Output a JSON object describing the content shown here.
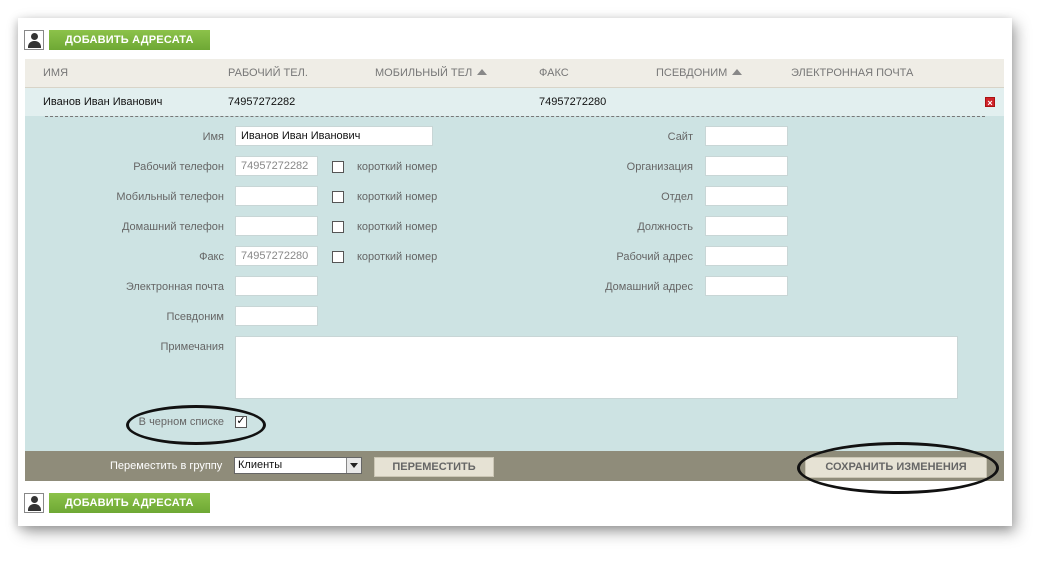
{
  "actions": {
    "add_recipient_label": "ДОБАВИТЬ АДРЕСАТА"
  },
  "table": {
    "headers": {
      "name": "ИМЯ",
      "work_phone": "РАБОЧИЙ ТЕЛ.",
      "mobile_phone": "МОБИЛЬНЫЙ ТЕЛ",
      "fax": "ФАКС",
      "alias": "ПСЕВДОНИМ",
      "email": "ЭЛЕКТРОННАЯ ПОЧТА"
    },
    "row": {
      "name": "Иванов Иван Иванович",
      "work_phone": "74957272282",
      "mobile_phone": "",
      "fax": "74957272280",
      "alias": "",
      "email": ""
    }
  },
  "form": {
    "name": {
      "label": "Имя",
      "value": "Иванов Иван Иванович"
    },
    "work_phone": {
      "label": "Рабочий телефон",
      "value": "74957272282"
    },
    "mobile_phone": {
      "label": "Мобильный телефон",
      "value": ""
    },
    "home_phone": {
      "label": "Домашний телефон",
      "value": ""
    },
    "fax": {
      "label": "Факс",
      "value": "74957272280"
    },
    "email": {
      "label": "Электронная почта",
      "value": ""
    },
    "alias": {
      "label": "Псевдоним",
      "value": ""
    },
    "notes": {
      "label": "Примечания",
      "value": ""
    },
    "short_number_label": "короткий номер",
    "site": {
      "label": "Сайт",
      "value": ""
    },
    "organization": {
      "label": "Организация",
      "value": ""
    },
    "department": {
      "label": "Отдел",
      "value": ""
    },
    "position": {
      "label": "Должность",
      "value": ""
    },
    "work_address": {
      "label": "Рабочий адрес",
      "value": ""
    },
    "home_address": {
      "label": "Домашний адрес",
      "value": ""
    },
    "blacklist": {
      "label": "В черном списке",
      "checked": true
    }
  },
  "footer": {
    "move_to_group_label": "Переместить в группу",
    "group_selected": "Клиенты",
    "move_button": "ПЕРЕМЕСТИТЬ",
    "save_button": "СОХРАНИТЬ ИЗМЕНЕНИЯ"
  },
  "colors": {
    "accent_green": "#7cb341",
    "form_bg": "#cde3e3",
    "footer_bg": "#8f8c7a",
    "delete_red": "#d0232a"
  },
  "icons": [
    "user-icon",
    "delete-icon",
    "sort-arrow-up-icon",
    "dropdown-arrow-icon"
  ]
}
